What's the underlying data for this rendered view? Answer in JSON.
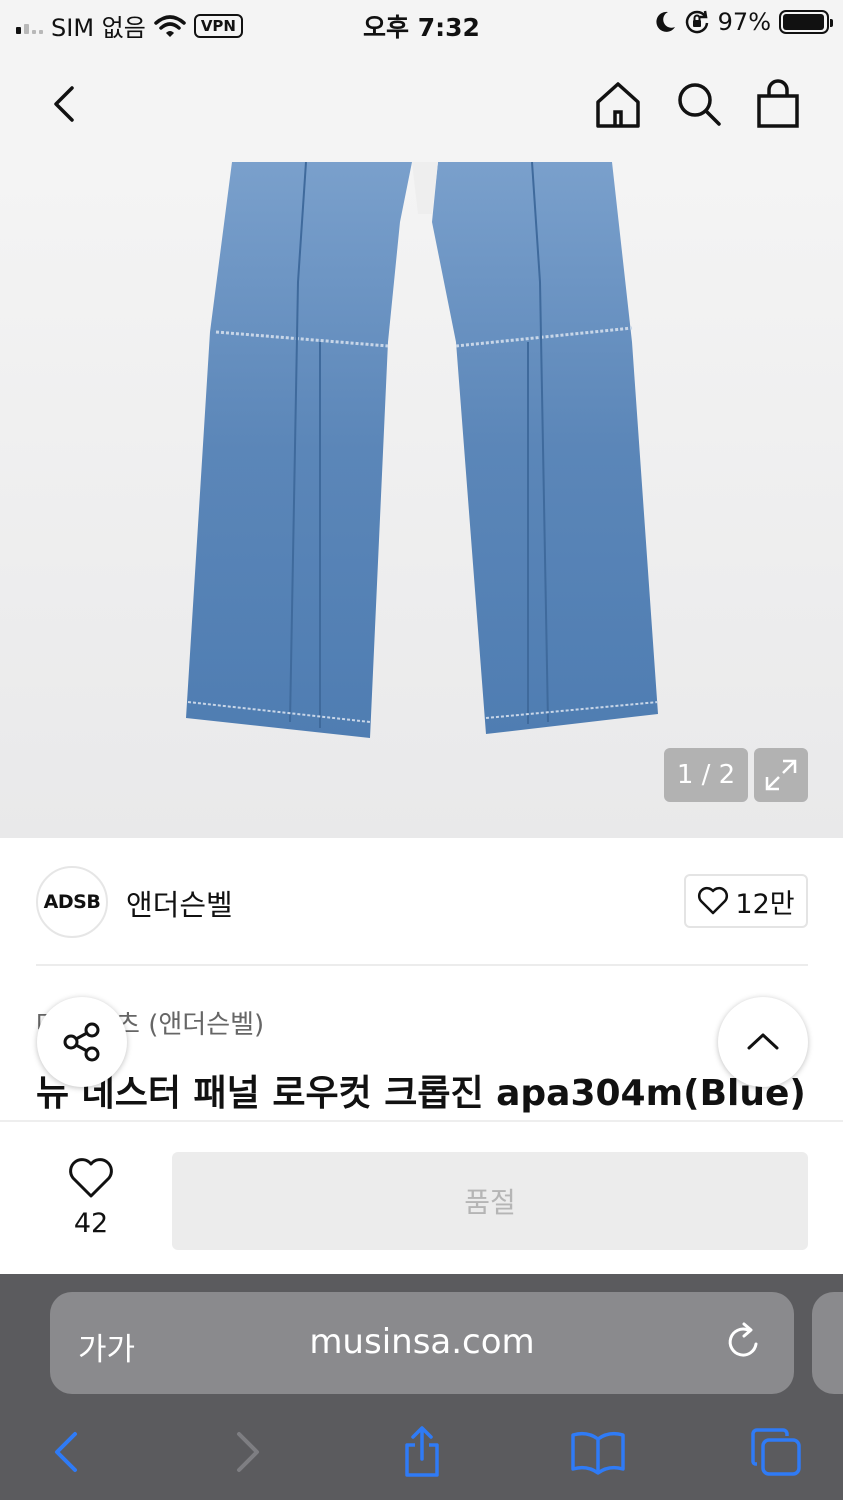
{
  "status_bar": {
    "carrier": "SIM 없음",
    "vpn": "VPN",
    "time": "오후 7:32",
    "battery": "97%",
    "battery_level": 0.97,
    "icons": [
      "signal-icon",
      "wifi-icon",
      "moon-icon",
      "orientation-lock-icon",
      "battery-icon"
    ]
  },
  "nav": {
    "icons": [
      "back-chevron-icon",
      "home-icon",
      "search-icon",
      "shopping-bag-icon"
    ]
  },
  "gallery": {
    "counter": "1 / 2",
    "icons": [
      "expand-icon"
    ]
  },
  "brand": {
    "logo_text": "ADSB",
    "name": "앤더슨벨",
    "like_count": "12만"
  },
  "product": {
    "category": "데님 팬츠 (앤더슨벨)",
    "title": "뉴 데스터 패널 로우컷 크롭진 apa304m(Blue)"
  },
  "buy_bar": {
    "wish_count": "42",
    "status_button": "품절"
  },
  "browser": {
    "aa_label": "가가",
    "url": "musinsa.com",
    "icons": [
      "reload-icon",
      "back-arrow-icon",
      "forward-arrow-icon",
      "share-icon",
      "bookmarks-icon",
      "tabs-icon"
    ]
  },
  "colors": {
    "accent": "#2f7bf6",
    "denim": "#5b86b8",
    "soldout_bg": "#ececec"
  }
}
